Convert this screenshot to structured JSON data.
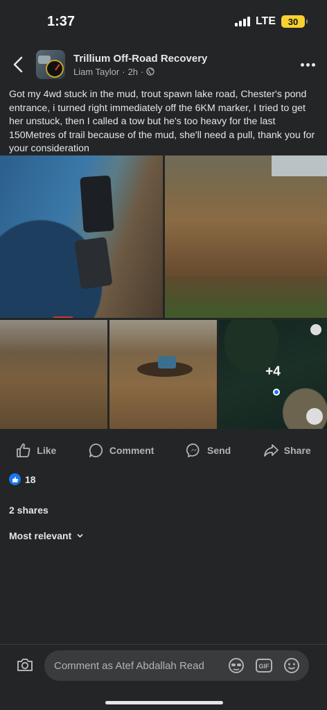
{
  "status_bar": {
    "time": "1:37",
    "network": "LTE",
    "battery": "30"
  },
  "post": {
    "page_name": "Trillium Off-Road Recovery",
    "author": "Liam Taylor",
    "time": "2h",
    "separator": "·",
    "text": "Got my 4wd stuck in the mud, trout spawn lake road, Chester's pond entrance, i turned right immediately off the 6KM marker, I tried to get her unstuck, then I called a tow but he's too heavy for the last 150Metres of trail because of the mud, she'll need a pull, thank you for your consideration",
    "more_photos": "+4"
  },
  "actions": {
    "like": "Like",
    "comment": "Comment",
    "send": "Send",
    "share": "Share"
  },
  "engagement": {
    "reactions": "18",
    "shares": "2 shares",
    "sort": "Most relevant"
  },
  "composer": {
    "placeholder": "Comment as Atef Abdallah Read"
  },
  "colors": {
    "background": "#242526",
    "accent": "#1877f2",
    "battery": "#f7d12e"
  }
}
